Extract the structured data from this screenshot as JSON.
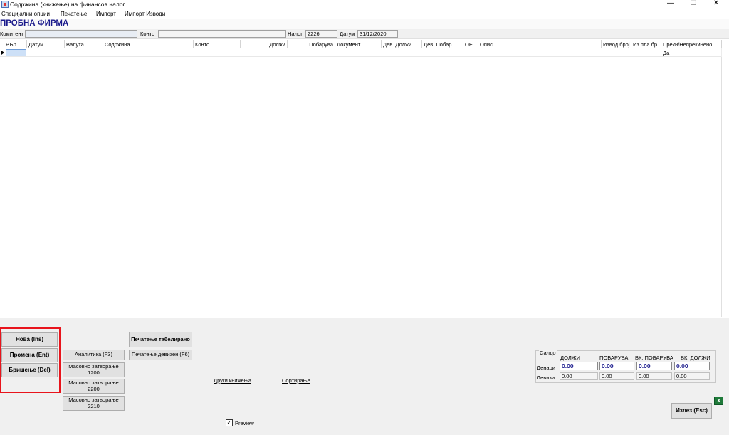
{
  "window": {
    "title": "Содржина (книжење) на финансов налог",
    "min": "—",
    "max": "❐",
    "close": "✕"
  },
  "menu": [
    "Специјални опции",
    "Печатење",
    "Импорт",
    "Импорт Изводи"
  ],
  "company": "ПРОБНА ФИРМА",
  "filters": {
    "komitent_label": "Комитент",
    "komitent_value": "",
    "konto_label": "Конто",
    "konto_value": "",
    "nalog_label": "Налог",
    "nalog_value": "2226",
    "datum_label": "Датум",
    "datum_value": "31/12/2020"
  },
  "grid": {
    "columns": [
      "Р.Бр.",
      "Датум",
      "Валута",
      "Содржина",
      "Конто",
      "",
      "Должи",
      "Побарува",
      "Документ",
      "Дев. Должи",
      "Дев. Побар.",
      "ОЕ",
      "Опис",
      "Извод број",
      "Из.пла.бр.",
      "Прекн/Непрекинено"
    ],
    "row": {
      "prekn": "Да"
    }
  },
  "buttons": {
    "nova": "Нова (Ins)",
    "promena": "Промена (Ent)",
    "brisenje": "Бришење (Del)",
    "analitika": "Аналитика (F3)",
    "mas1200": "Масовно затворање 1200",
    "mas2200": "Масовно затворање 2200",
    "mas2210": "Масовно затворање 2210",
    "pecatenje_tab": "Печатење табелирано",
    "pecatenje_dev": "Печатење девизен (F6)",
    "izlez": "Излез (Esc)"
  },
  "links": {
    "drugi": "Други книжења",
    "sortiranje": "Сортирање"
  },
  "preview": {
    "label": "Preview",
    "checked": "✓"
  },
  "saldo": {
    "title": "Салдо",
    "headers": [
      "ДОЛЖИ",
      "ПОБАРУВА",
      "ВК. ПОБАРУВА",
      "ВК. ДОЛЖИ"
    ],
    "denari_label": "Денари",
    "devizi_label": "Девизи",
    "denari": [
      "0.00",
      "0.00",
      "0.00",
      "0.00"
    ],
    "devizi": [
      "0.00",
      "0.00",
      "0.00",
      "0.00"
    ]
  }
}
